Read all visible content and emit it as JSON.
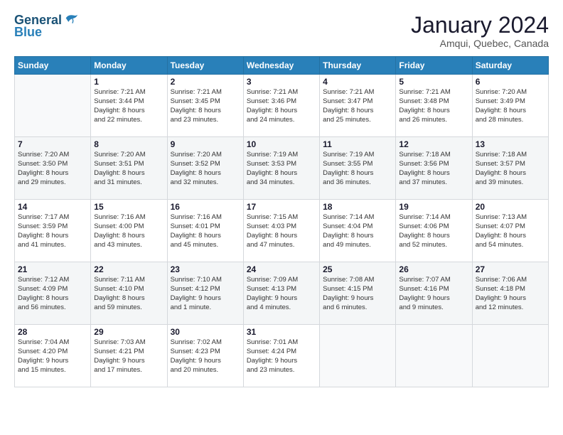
{
  "header": {
    "logo_line1": "General",
    "logo_line2": "Blue",
    "month": "January 2024",
    "location": "Amqui, Quebec, Canada"
  },
  "weekdays": [
    "Sunday",
    "Monday",
    "Tuesday",
    "Wednesday",
    "Thursday",
    "Friday",
    "Saturday"
  ],
  "weeks": [
    [
      {
        "day": "",
        "info": ""
      },
      {
        "day": "1",
        "info": "Sunrise: 7:21 AM\nSunset: 3:44 PM\nDaylight: 8 hours\nand 22 minutes."
      },
      {
        "day": "2",
        "info": "Sunrise: 7:21 AM\nSunset: 3:45 PM\nDaylight: 8 hours\nand 23 minutes."
      },
      {
        "day": "3",
        "info": "Sunrise: 7:21 AM\nSunset: 3:46 PM\nDaylight: 8 hours\nand 24 minutes."
      },
      {
        "day": "4",
        "info": "Sunrise: 7:21 AM\nSunset: 3:47 PM\nDaylight: 8 hours\nand 25 minutes."
      },
      {
        "day": "5",
        "info": "Sunrise: 7:21 AM\nSunset: 3:48 PM\nDaylight: 8 hours\nand 26 minutes."
      },
      {
        "day": "6",
        "info": "Sunrise: 7:20 AM\nSunset: 3:49 PM\nDaylight: 8 hours\nand 28 minutes."
      }
    ],
    [
      {
        "day": "7",
        "info": "Sunrise: 7:20 AM\nSunset: 3:50 PM\nDaylight: 8 hours\nand 29 minutes."
      },
      {
        "day": "8",
        "info": "Sunrise: 7:20 AM\nSunset: 3:51 PM\nDaylight: 8 hours\nand 31 minutes."
      },
      {
        "day": "9",
        "info": "Sunrise: 7:20 AM\nSunset: 3:52 PM\nDaylight: 8 hours\nand 32 minutes."
      },
      {
        "day": "10",
        "info": "Sunrise: 7:19 AM\nSunset: 3:53 PM\nDaylight: 8 hours\nand 34 minutes."
      },
      {
        "day": "11",
        "info": "Sunrise: 7:19 AM\nSunset: 3:55 PM\nDaylight: 8 hours\nand 36 minutes."
      },
      {
        "day": "12",
        "info": "Sunrise: 7:18 AM\nSunset: 3:56 PM\nDaylight: 8 hours\nand 37 minutes."
      },
      {
        "day": "13",
        "info": "Sunrise: 7:18 AM\nSunset: 3:57 PM\nDaylight: 8 hours\nand 39 minutes."
      }
    ],
    [
      {
        "day": "14",
        "info": "Sunrise: 7:17 AM\nSunset: 3:59 PM\nDaylight: 8 hours\nand 41 minutes."
      },
      {
        "day": "15",
        "info": "Sunrise: 7:16 AM\nSunset: 4:00 PM\nDaylight: 8 hours\nand 43 minutes."
      },
      {
        "day": "16",
        "info": "Sunrise: 7:16 AM\nSunset: 4:01 PM\nDaylight: 8 hours\nand 45 minutes."
      },
      {
        "day": "17",
        "info": "Sunrise: 7:15 AM\nSunset: 4:03 PM\nDaylight: 8 hours\nand 47 minutes."
      },
      {
        "day": "18",
        "info": "Sunrise: 7:14 AM\nSunset: 4:04 PM\nDaylight: 8 hours\nand 49 minutes."
      },
      {
        "day": "19",
        "info": "Sunrise: 7:14 AM\nSunset: 4:06 PM\nDaylight: 8 hours\nand 52 minutes."
      },
      {
        "day": "20",
        "info": "Sunrise: 7:13 AM\nSunset: 4:07 PM\nDaylight: 8 hours\nand 54 minutes."
      }
    ],
    [
      {
        "day": "21",
        "info": "Sunrise: 7:12 AM\nSunset: 4:09 PM\nDaylight: 8 hours\nand 56 minutes."
      },
      {
        "day": "22",
        "info": "Sunrise: 7:11 AM\nSunset: 4:10 PM\nDaylight: 8 hours\nand 59 minutes."
      },
      {
        "day": "23",
        "info": "Sunrise: 7:10 AM\nSunset: 4:12 PM\nDaylight: 9 hours\nand 1 minute."
      },
      {
        "day": "24",
        "info": "Sunrise: 7:09 AM\nSunset: 4:13 PM\nDaylight: 9 hours\nand 4 minutes."
      },
      {
        "day": "25",
        "info": "Sunrise: 7:08 AM\nSunset: 4:15 PM\nDaylight: 9 hours\nand 6 minutes."
      },
      {
        "day": "26",
        "info": "Sunrise: 7:07 AM\nSunset: 4:16 PM\nDaylight: 9 hours\nand 9 minutes."
      },
      {
        "day": "27",
        "info": "Sunrise: 7:06 AM\nSunset: 4:18 PM\nDaylight: 9 hours\nand 12 minutes."
      }
    ],
    [
      {
        "day": "28",
        "info": "Sunrise: 7:04 AM\nSunset: 4:20 PM\nDaylight: 9 hours\nand 15 minutes."
      },
      {
        "day": "29",
        "info": "Sunrise: 7:03 AM\nSunset: 4:21 PM\nDaylight: 9 hours\nand 17 minutes."
      },
      {
        "day": "30",
        "info": "Sunrise: 7:02 AM\nSunset: 4:23 PM\nDaylight: 9 hours\nand 20 minutes."
      },
      {
        "day": "31",
        "info": "Sunrise: 7:01 AM\nSunset: 4:24 PM\nDaylight: 9 hours\nand 23 minutes."
      },
      {
        "day": "",
        "info": ""
      },
      {
        "day": "",
        "info": ""
      },
      {
        "day": "",
        "info": ""
      }
    ]
  ]
}
